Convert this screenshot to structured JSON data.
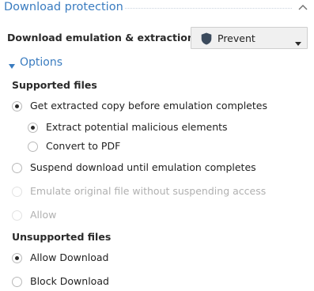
{
  "section": {
    "title": "Download protection"
  },
  "emulation": {
    "label": "Download emulation & extraction",
    "dropdown_value": "Prevent"
  },
  "options": {
    "label": "Options",
    "supported_title": "Supported files",
    "supported": [
      {
        "label": "Get extracted copy before emulation completes",
        "checked": true,
        "disabled": false
      },
      {
        "label": "Extract potential malicious elements",
        "checked": true,
        "disabled": false
      },
      {
        "label": "Convert to PDF",
        "checked": false,
        "disabled": false
      },
      {
        "label": "Suspend download until emulation completes",
        "checked": false,
        "disabled": false
      },
      {
        "label": "Emulate original file without suspending access",
        "checked": false,
        "disabled": true
      },
      {
        "label": "Allow",
        "checked": false,
        "disabled": true
      }
    ],
    "unsupported_title": "Unsupported files",
    "unsupported": [
      {
        "label": "Allow Download",
        "checked": true,
        "disabled": false
      },
      {
        "label": "Block Download",
        "checked": false,
        "disabled": false
      }
    ]
  },
  "colors": {
    "accent": "#3a7cc0",
    "disabled_text": "#b0b0b0",
    "dropdown_bg": "#f0f0f0",
    "shield": "#3b4a5c"
  }
}
